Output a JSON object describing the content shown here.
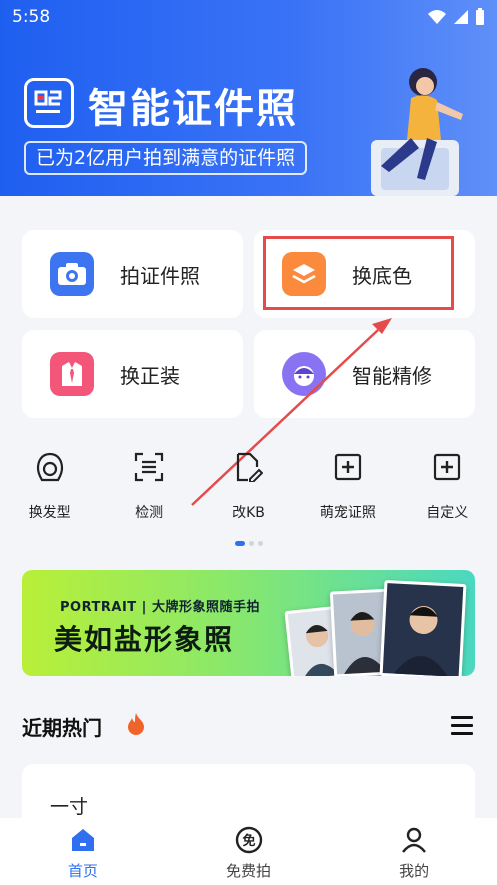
{
  "status_bar": {
    "time": "5:58"
  },
  "banner": {
    "title": "智能证件照",
    "subtitle": "已为2亿用户拍到满意的证件照"
  },
  "cards": [
    {
      "label": "拍证件照",
      "icon": "camera-icon"
    },
    {
      "label": "换底色",
      "icon": "layers-icon"
    },
    {
      "label": "换正装",
      "icon": "suit-icon"
    },
    {
      "label": "智能精修",
      "icon": "retouch-face-icon"
    }
  ],
  "tools": [
    {
      "label": "换发型",
      "icon": "hairstyle-icon"
    },
    {
      "label": "检测",
      "icon": "scan-icon"
    },
    {
      "label": "改KB",
      "icon": "edit-file-icon"
    },
    {
      "label": "萌宠证照",
      "icon": "plus-square-icon"
    },
    {
      "label": "自定义",
      "icon": "plus-square-icon"
    }
  ],
  "promo": {
    "top_line": "PORTRAIT | 大牌形象照随手拍",
    "headline": "美如盐形象照"
  },
  "section": {
    "title": "近期热门"
  },
  "list": [
    {
      "label": "一寸"
    }
  ],
  "tabbar": [
    {
      "label": "首页",
      "icon": "home-icon",
      "active": true
    },
    {
      "label": "免费拍",
      "icon": "free-badge-icon",
      "active": false
    },
    {
      "label": "我的",
      "icon": "user-icon",
      "active": false
    }
  ],
  "colors": {
    "brand": "#2f6ff0",
    "highlight": "#e64b4b"
  }
}
